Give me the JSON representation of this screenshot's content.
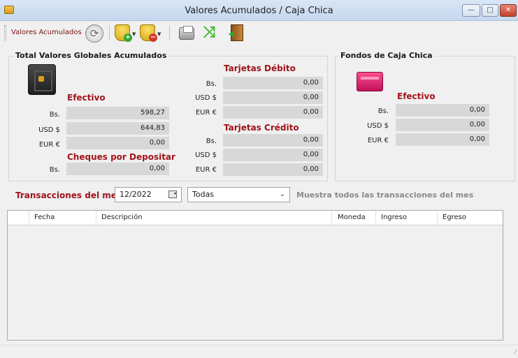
{
  "window": {
    "title": "Valores Acumulados / Caja Chica",
    "controls": {
      "minimize": "—",
      "maximize": "□",
      "close": "✕"
    }
  },
  "toolbar": {
    "label": "Valores Acumulados",
    "icons": [
      "refresh-icon",
      "add-coins-icon",
      "remove-coins-icon",
      "print-icon",
      "shuffle-icon",
      "exit-icon"
    ]
  },
  "global": {
    "title": "Total Valores Globales Acumulados",
    "efectivo": {
      "title": "Efectivo",
      "rows": [
        {
          "label": "Bs.",
          "value": "598,27"
        },
        {
          "label": "USD $",
          "value": "644,83"
        },
        {
          "label": "EUR €",
          "value": "0,00"
        }
      ]
    },
    "cheques": {
      "title": "Cheques por Depositar",
      "rows": [
        {
          "label": "Bs.",
          "value": "0,00"
        }
      ]
    },
    "debito": {
      "title": "Tarjetas Débito",
      "rows": [
        {
          "label": "Bs.",
          "value": "0,00"
        },
        {
          "label": "USD $",
          "value": "0,00"
        },
        {
          "label": "EUR €",
          "value": "0,00"
        }
      ]
    },
    "credito": {
      "title": "Tarjetas Crédito",
      "rows": [
        {
          "label": "Bs.",
          "value": "0,00"
        },
        {
          "label": "USD $",
          "value": "0,00"
        },
        {
          "label": "EUR €",
          "value": "0,00"
        }
      ]
    }
  },
  "caja": {
    "title": "Fondos de Caja Chica",
    "efectivo": {
      "title": "Efectivo",
      "rows": [
        {
          "label": "Bs.",
          "value": "0,00"
        },
        {
          "label": "USD $",
          "value": "0,00"
        },
        {
          "label": "EUR €",
          "value": "0,00"
        }
      ]
    }
  },
  "transactions": {
    "label": "Transacciones del mes",
    "month": "12/2022",
    "filter": "Todas",
    "hint": "Muestra todos las transacciones del mes",
    "columns": [
      "Fecha",
      "Descripción",
      "Moneda",
      "Ingreso",
      "Egreso"
    ],
    "rows": []
  }
}
